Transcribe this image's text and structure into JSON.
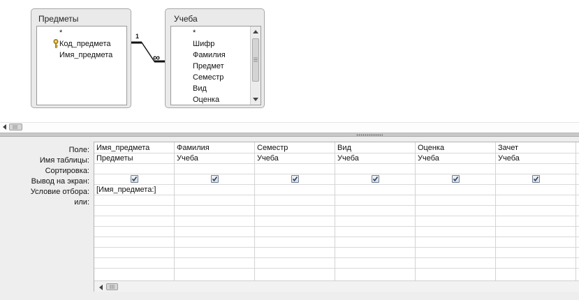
{
  "tables": [
    {
      "title": "Предметы",
      "fields": [
        {
          "name": "*",
          "is_key": false
        },
        {
          "name": "Код_предмета",
          "is_key": true
        },
        {
          "name": "Имя_предмета",
          "is_key": false
        }
      ]
    },
    {
      "title": "Учеба",
      "fields": [
        {
          "name": "*",
          "is_key": false
        },
        {
          "name": "Шифр",
          "is_key": false
        },
        {
          "name": "Фамилия",
          "is_key": false
        },
        {
          "name": "Предмет",
          "is_key": false
        },
        {
          "name": "Семестр",
          "is_key": false
        },
        {
          "name": "Вид",
          "is_key": false
        },
        {
          "name": "Оценка",
          "is_key": false
        }
      ]
    }
  ],
  "relationship": {
    "one_label": "1",
    "many_label": "∞"
  },
  "grid": {
    "row_labels": [
      "Поле:",
      "Имя таблицы:",
      "Сортировка:",
      "Вывод на экран:",
      "Условие отбора:",
      "или:"
    ],
    "columns": [
      {
        "field": "Имя_предмета",
        "table": "Предметы",
        "sort": "",
        "show": true,
        "criteria": "[Имя_предмета:]"
      },
      {
        "field": "Фамилия",
        "table": "Учеба",
        "sort": "",
        "show": true,
        "criteria": ""
      },
      {
        "field": "Семестр",
        "table": "Учеба",
        "sort": "",
        "show": true,
        "criteria": ""
      },
      {
        "field": "Вид",
        "table": "Учеба",
        "sort": "",
        "show": true,
        "criteria": ""
      },
      {
        "field": "Оценка",
        "table": "Учеба",
        "sort": "",
        "show": true,
        "criteria": ""
      },
      {
        "field": "Зачет",
        "table": "Учеба",
        "sort": "",
        "show": true,
        "criteria": ""
      }
    ]
  },
  "colors": {
    "grid_bg": "#eeeeee",
    "table_bg": "#eaeaea",
    "key_icon": "#c9a227"
  }
}
